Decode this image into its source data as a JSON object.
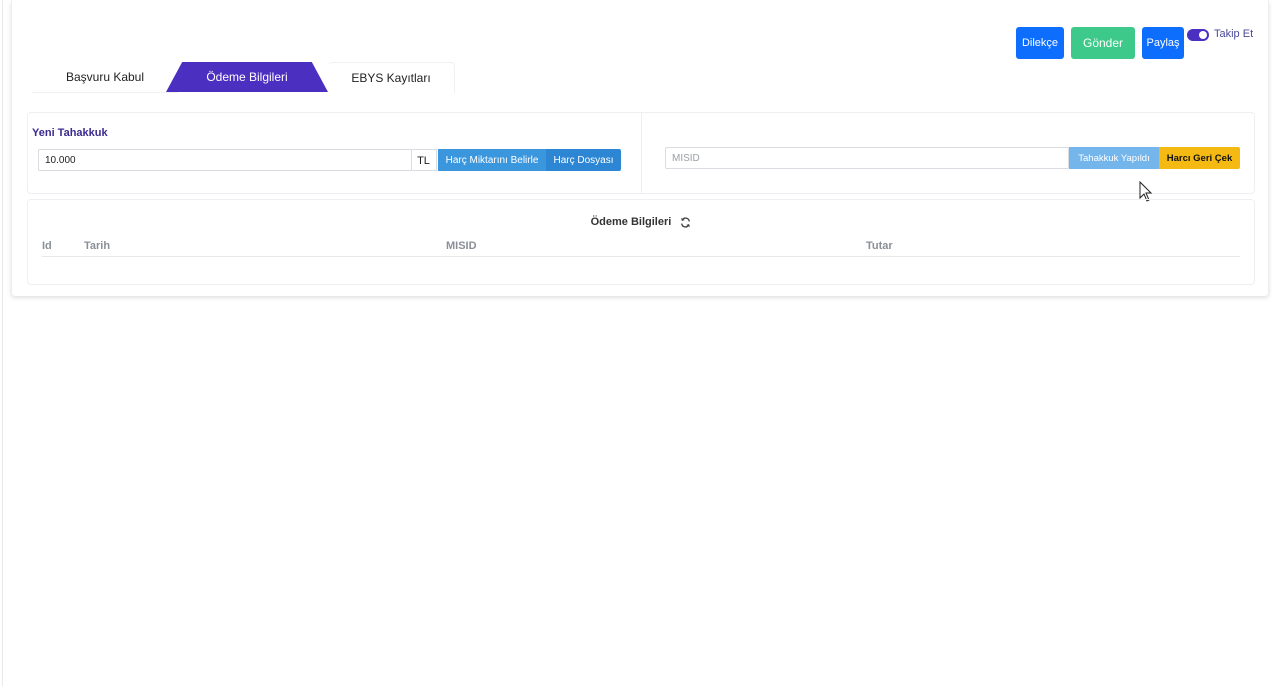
{
  "tabs": [
    {
      "label": "Başvuru Kabul",
      "active": false
    },
    {
      "label": "Ödeme Bilgileri",
      "active": true
    },
    {
      "label": "EBYS Kayıtları",
      "active": false
    }
  ],
  "toolbar": {
    "dilekce_label": "Dilekçe",
    "gonder_label": "Gönder",
    "paylas_label": "Paylaş",
    "follow_label": "Takip Et",
    "follow_on": true
  },
  "new_accrual": {
    "title": "Yeni Tahakkuk",
    "amount_value": "10.000",
    "currency": "TL",
    "set_amount_label": "Harç Miktarını Belirle",
    "fee_file_label": "Harç Dosyası"
  },
  "misid": {
    "placeholder": "MISID",
    "accrual_done_label": "Tahakkuk Yapıldı",
    "withdraw_label": "Harcı Geri Çek"
  },
  "payments": {
    "title": "Ödeme Bilgileri",
    "columns": [
      "Id",
      "Tarih",
      "MISID",
      "Tutar"
    ],
    "rows": []
  },
  "colors": {
    "accent": "#4a2fc0",
    "primary": "#0d6efd",
    "success": "#3cc98a",
    "info": "#3a97de",
    "warning": "#f5b914"
  },
  "icons": {
    "refresh": "refresh-icon",
    "cursor": "mouse-cursor-icon"
  }
}
